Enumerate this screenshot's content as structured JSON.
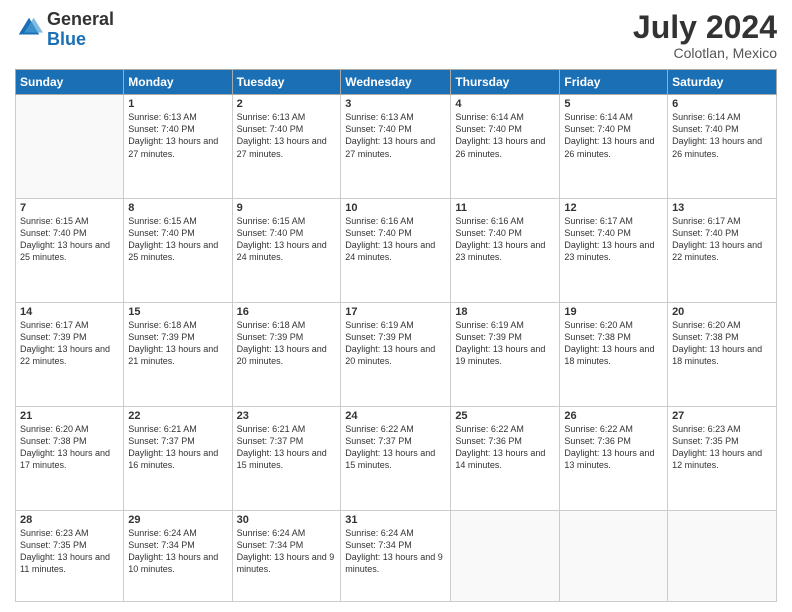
{
  "header": {
    "logo_general": "General",
    "logo_blue": "Blue",
    "month": "July 2024",
    "location": "Colotlan, Mexico"
  },
  "weekdays": [
    "Sunday",
    "Monday",
    "Tuesday",
    "Wednesday",
    "Thursday",
    "Friday",
    "Saturday"
  ],
  "weeks": [
    [
      {
        "day": "",
        "sunrise": "",
        "sunset": "",
        "daylight": ""
      },
      {
        "day": "1",
        "sunrise": "6:13 AM",
        "sunset": "7:40 PM",
        "daylight": "13 hours and 27 minutes."
      },
      {
        "day": "2",
        "sunrise": "6:13 AM",
        "sunset": "7:40 PM",
        "daylight": "13 hours and 27 minutes."
      },
      {
        "day": "3",
        "sunrise": "6:13 AM",
        "sunset": "7:40 PM",
        "daylight": "13 hours and 27 minutes."
      },
      {
        "day": "4",
        "sunrise": "6:14 AM",
        "sunset": "7:40 PM",
        "daylight": "13 hours and 26 minutes."
      },
      {
        "day": "5",
        "sunrise": "6:14 AM",
        "sunset": "7:40 PM",
        "daylight": "13 hours and 26 minutes."
      },
      {
        "day": "6",
        "sunrise": "6:14 AM",
        "sunset": "7:40 PM",
        "daylight": "13 hours and 26 minutes."
      }
    ],
    [
      {
        "day": "7",
        "sunrise": "6:15 AM",
        "sunset": "7:40 PM",
        "daylight": "13 hours and 25 minutes."
      },
      {
        "day": "8",
        "sunrise": "6:15 AM",
        "sunset": "7:40 PM",
        "daylight": "13 hours and 25 minutes."
      },
      {
        "day": "9",
        "sunrise": "6:15 AM",
        "sunset": "7:40 PM",
        "daylight": "13 hours and 24 minutes."
      },
      {
        "day": "10",
        "sunrise": "6:16 AM",
        "sunset": "7:40 PM",
        "daylight": "13 hours and 24 minutes."
      },
      {
        "day": "11",
        "sunrise": "6:16 AM",
        "sunset": "7:40 PM",
        "daylight": "13 hours and 23 minutes."
      },
      {
        "day": "12",
        "sunrise": "6:17 AM",
        "sunset": "7:40 PM",
        "daylight": "13 hours and 23 minutes."
      },
      {
        "day": "13",
        "sunrise": "6:17 AM",
        "sunset": "7:40 PM",
        "daylight": "13 hours and 22 minutes."
      }
    ],
    [
      {
        "day": "14",
        "sunrise": "6:17 AM",
        "sunset": "7:39 PM",
        "daylight": "13 hours and 22 minutes."
      },
      {
        "day": "15",
        "sunrise": "6:18 AM",
        "sunset": "7:39 PM",
        "daylight": "13 hours and 21 minutes."
      },
      {
        "day": "16",
        "sunrise": "6:18 AM",
        "sunset": "7:39 PM",
        "daylight": "13 hours and 20 minutes."
      },
      {
        "day": "17",
        "sunrise": "6:19 AM",
        "sunset": "7:39 PM",
        "daylight": "13 hours and 20 minutes."
      },
      {
        "day": "18",
        "sunrise": "6:19 AM",
        "sunset": "7:39 PM",
        "daylight": "13 hours and 19 minutes."
      },
      {
        "day": "19",
        "sunrise": "6:20 AM",
        "sunset": "7:38 PM",
        "daylight": "13 hours and 18 minutes."
      },
      {
        "day": "20",
        "sunrise": "6:20 AM",
        "sunset": "7:38 PM",
        "daylight": "13 hours and 18 minutes."
      }
    ],
    [
      {
        "day": "21",
        "sunrise": "6:20 AM",
        "sunset": "7:38 PM",
        "daylight": "13 hours and 17 minutes."
      },
      {
        "day": "22",
        "sunrise": "6:21 AM",
        "sunset": "7:37 PM",
        "daylight": "13 hours and 16 minutes."
      },
      {
        "day": "23",
        "sunrise": "6:21 AM",
        "sunset": "7:37 PM",
        "daylight": "13 hours and 15 minutes."
      },
      {
        "day": "24",
        "sunrise": "6:22 AM",
        "sunset": "7:37 PM",
        "daylight": "13 hours and 15 minutes."
      },
      {
        "day": "25",
        "sunrise": "6:22 AM",
        "sunset": "7:36 PM",
        "daylight": "13 hours and 14 minutes."
      },
      {
        "day": "26",
        "sunrise": "6:22 AM",
        "sunset": "7:36 PM",
        "daylight": "13 hours and 13 minutes."
      },
      {
        "day": "27",
        "sunrise": "6:23 AM",
        "sunset": "7:35 PM",
        "daylight": "13 hours and 12 minutes."
      }
    ],
    [
      {
        "day": "28",
        "sunrise": "6:23 AM",
        "sunset": "7:35 PM",
        "daylight": "13 hours and 11 minutes."
      },
      {
        "day": "29",
        "sunrise": "6:24 AM",
        "sunset": "7:34 PM",
        "daylight": "13 hours and 10 minutes."
      },
      {
        "day": "30",
        "sunrise": "6:24 AM",
        "sunset": "7:34 PM",
        "daylight": "13 hours and 9 minutes."
      },
      {
        "day": "31",
        "sunrise": "6:24 AM",
        "sunset": "7:34 PM",
        "daylight": "13 hours and 9 minutes."
      },
      {
        "day": "",
        "sunrise": "",
        "sunset": "",
        "daylight": ""
      },
      {
        "day": "",
        "sunrise": "",
        "sunset": "",
        "daylight": ""
      },
      {
        "day": "",
        "sunrise": "",
        "sunset": "",
        "daylight": ""
      }
    ]
  ]
}
